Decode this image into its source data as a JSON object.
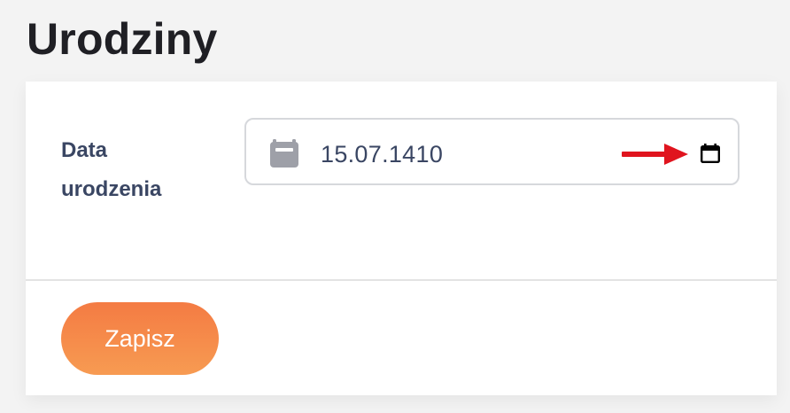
{
  "page": {
    "title": "Urodziny"
  },
  "form": {
    "birthdate_label": "Data urodzenia",
    "birthdate_value": "15.07.1410",
    "save_label": "Zapisz"
  },
  "icons": {
    "field_icon": "calendar-icon",
    "picker_icon": "calendar-picker-icon",
    "annotation": "red-arrow-icon"
  },
  "colors": {
    "title_text": "#1f1f24",
    "label_text": "#3a4663",
    "field_icon": "#9ea0a8",
    "annotation_arrow": "#e0141e",
    "button_gradient_top": "#f47b43",
    "button_gradient_bottom": "#f79b52",
    "button_text": "#ffffff"
  }
}
